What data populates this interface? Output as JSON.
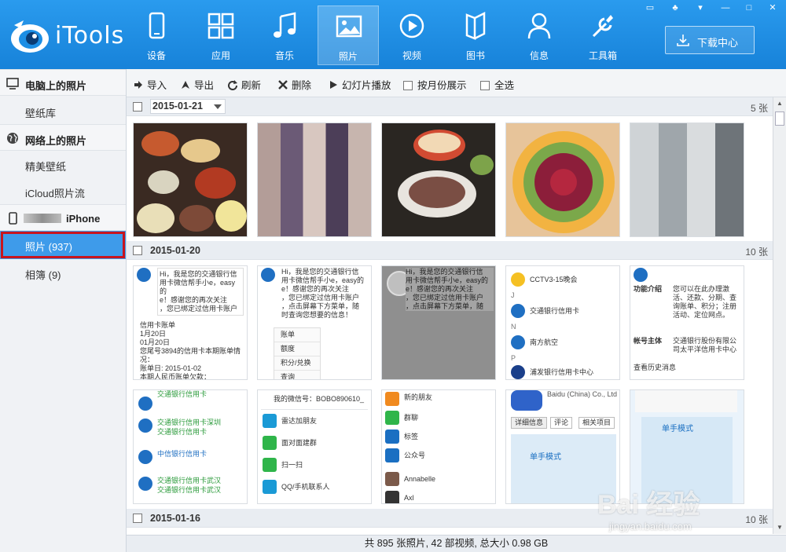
{
  "app": {
    "name": "iTools",
    "brand_color": "#1c8ee4"
  },
  "window_controls": [
    "speech-icon",
    "shirt-icon",
    "dropdown-icon",
    "minimize-icon",
    "maximize-icon",
    "close-icon"
  ],
  "nav": [
    {
      "label": "设备",
      "icon": "device-icon"
    },
    {
      "label": "应用",
      "icon": "apps-icon"
    },
    {
      "label": "音乐",
      "icon": "music-icon"
    },
    {
      "label": "照片",
      "icon": "photo-icon",
      "active": true
    },
    {
      "label": "视频",
      "icon": "video-icon"
    },
    {
      "label": "图书",
      "icon": "book-icon"
    },
    {
      "label": "信息",
      "icon": "contacts-icon"
    },
    {
      "label": "工具箱",
      "icon": "toolbox-icon"
    }
  ],
  "download_button": {
    "label": "下载中心",
    "icon": "download-icon"
  },
  "sidebar": {
    "sections": [
      {
        "title": "电脑上的照片",
        "icon": "monitor-icon",
        "items": [
          "壁纸库"
        ]
      },
      {
        "title": "网络上的照片",
        "icon": "globe-icon",
        "items": [
          "精美壁纸",
          "iCloud照片流"
        ]
      },
      {
        "title": "iPhone",
        "icon": "phone-icon",
        "items": [
          "照片 (937)",
          "相簿 (9)"
        ],
        "selected_item": "照片 (937)"
      }
    ]
  },
  "toolbar": {
    "import": "导入",
    "export": "导出",
    "refresh": "刷新",
    "delete": "删除",
    "slideshow": "幻灯片播放",
    "by_month": "按月份展示",
    "select_all": "全选"
  },
  "groups": [
    {
      "date": "2015-01-21",
      "count": "5 张",
      "has_dropdown": true
    },
    {
      "date": "2015-01-20",
      "count": "10 张"
    },
    {
      "date": "2015-01-16",
      "count": "10 张"
    }
  ],
  "screenshot_texts": {
    "wechat_msg": [
      "Hi，我是您的交通银行信",
      "用卡微信帮手小e，easy的",
      "e！感谢您的再次关注",
      "，您已绑定过信用卡账户",
      "，点击屏幕下方菜单，随",
      "时查询您想要的信息！"
    ],
    "bill": [
      "信用卡账单",
      "1月20日",
      "01月20日",
      "您尾号3894的信用卡本期账单情况：",
      "账单日:    2015-01-02",
      "本期人民币账单欠款："
    ],
    "menu": [
      "账单",
      "额度",
      "积分/兑换",
      "查询"
    ],
    "contacts": [
      "CCTV3-15晚会",
      "交通银行信用卡",
      "南方航空",
      "浦发银行信用卡中心"
    ],
    "letters": [
      "J",
      "N",
      "P"
    ],
    "intro": [
      "功能介绍",
      "您可以在此办理激活、还款、分期、查询账单、积分；注册活动、定位网点。",
      "帐号主体",
      "交通银行股份有限公司太平洋信用卡中心",
      "查看历史消息"
    ],
    "chats": [
      "交通银行信用卡",
      "交通银行信用卡深圳",
      "交通银行信用卡",
      "中信银行信用卡",
      "交通银行信用卡武汉",
      "交通银行信用卡武汉"
    ],
    "wechat_id": "我的微信号：BOBO890610_",
    "add_friend": [
      "雷达加朋友",
      "面对面建群",
      "扫一扫",
      "QQ/手机联系人"
    ],
    "contacts_menu": [
      "新的朋友",
      "群聊",
      "标签",
      "公众号",
      "Annabelle",
      "Axl"
    ],
    "app_store": [
      "Baidu (China) Co., Ltd",
      "详细信息",
      "评论",
      "相关项目",
      "单手模式"
    ]
  },
  "status": "共 895 张照片, 42 部视频, 总大小 0.98 GB",
  "watermark": {
    "main": "Bai 经验",
    "sub": "jingyan.baidu.com"
  }
}
